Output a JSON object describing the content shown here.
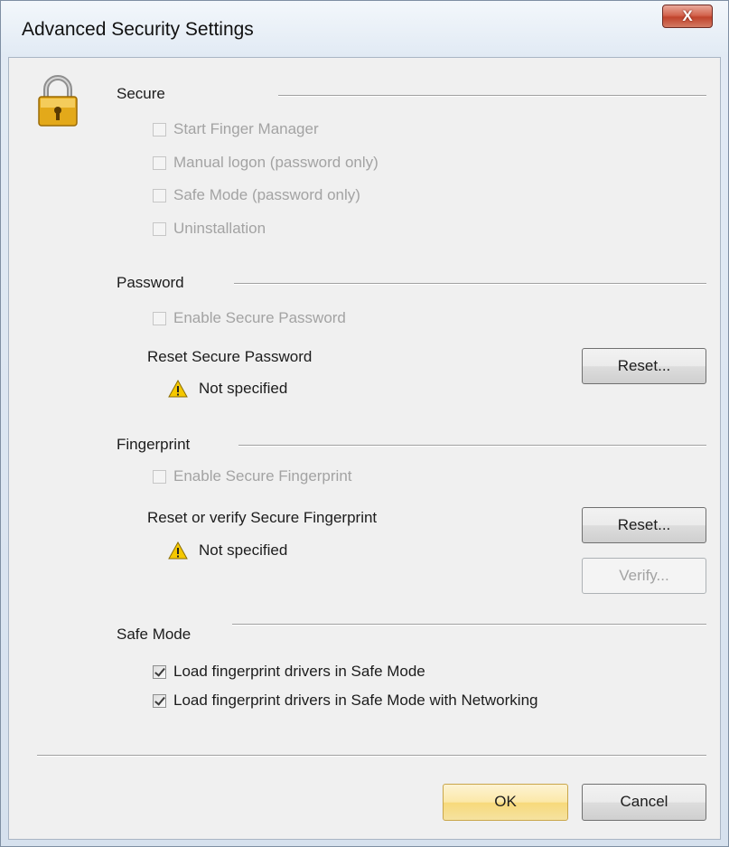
{
  "window": {
    "title": "Advanced Security Settings",
    "close_glyph": "X",
    "icon": "padlock-icon"
  },
  "secure": {
    "title": "Secure",
    "options": [
      {
        "label": "Start Finger Manager",
        "checked": false,
        "enabled": false
      },
      {
        "label": "Manual logon (password only)",
        "checked": false,
        "enabled": false
      },
      {
        "label": "Safe Mode (password only)",
        "checked": false,
        "enabled": false
      },
      {
        "label": "Uninstallation",
        "checked": false,
        "enabled": false
      }
    ]
  },
  "password": {
    "title": "Password",
    "enable_label": "Enable Secure Password",
    "reset_label": "Reset Secure Password",
    "status": "Not specified",
    "reset_button": "Reset..."
  },
  "fingerprint": {
    "title": "Fingerprint",
    "enable_label": "Enable Secure Fingerprint",
    "reset_label": "Reset or verify Secure Fingerprint",
    "status": "Not specified",
    "reset_button": "Reset...",
    "verify_button": "Verify..."
  },
  "safe_mode": {
    "title": "Safe Mode",
    "options": [
      {
        "label": "Load fingerprint drivers in Safe Mode",
        "checked": true,
        "enabled": true
      },
      {
        "label": "Load fingerprint drivers in Safe Mode with Networking",
        "checked": true,
        "enabled": true
      }
    ]
  },
  "footer": {
    "ok_label": "OK",
    "cancel_label": "Cancel"
  },
  "colors": {
    "warning": "#f5c800",
    "lock_gold": "#e3a91a",
    "close_red": "#c0432c"
  }
}
